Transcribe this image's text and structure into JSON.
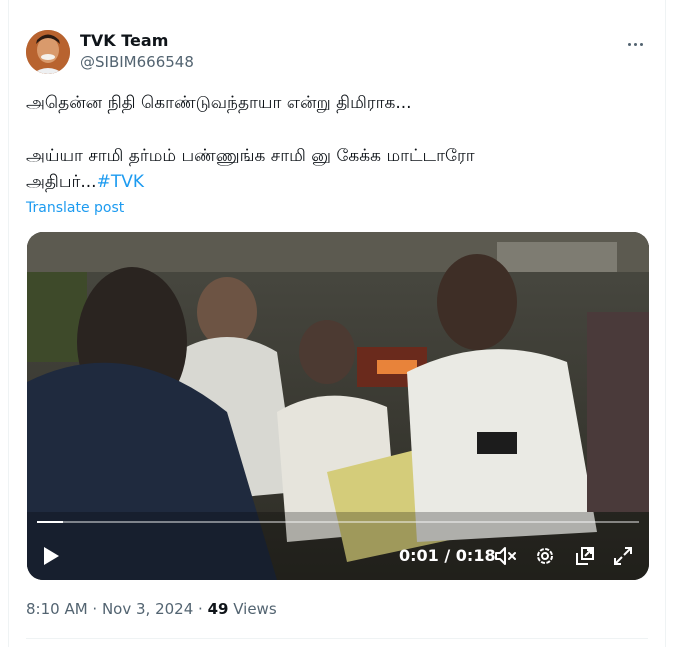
{
  "author": {
    "name": "TVK Team",
    "handle": "@SIBIM666548"
  },
  "post": {
    "line1": "அதென்ன நிதி கொண்டுவந்தாயா என்று திமிராக...",
    "line2": "அய்யா சாமி தர்மம் பண்ணுங்க சாமி னு கேக்க மாட்டாரோ",
    "line3": "அதிபர்...",
    "hashtag": "#TVK",
    "translate_label": "Translate post"
  },
  "video": {
    "current_time": "0:01",
    "duration": "0:18",
    "time_display": "0:01 / 0:18",
    "progress_fraction": 0.044,
    "controls": [
      "play-icon",
      "mute-icon",
      "settings-icon",
      "pip-icon",
      "fullscreen-icon"
    ]
  },
  "meta": {
    "timestamp": "8:10 AM · Nov 3, 2024",
    "separator": " · ",
    "views_count": "49",
    "views_label": "Views"
  },
  "colors": {
    "accent": "#1d9bf0",
    "text": "#0f1419",
    "secondary": "#536471"
  }
}
